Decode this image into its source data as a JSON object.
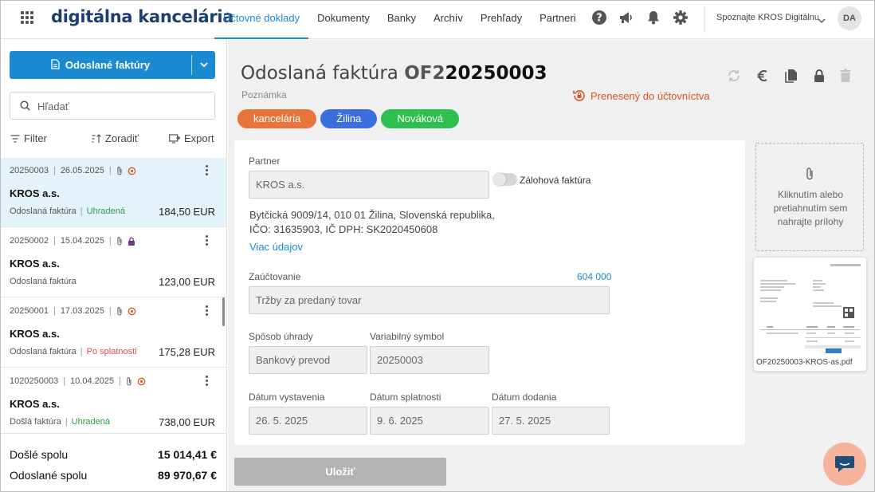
{
  "app": {
    "logo": "digitálna kancelária"
  },
  "nav": [
    "Účtovné doklady",
    "Dokumenty",
    "Banky",
    "Archív",
    "Prehľady",
    "Partneri"
  ],
  "header": {
    "promo": "Spoznajte KROS Digitálnu",
    "avatar": "DA"
  },
  "sidebar": {
    "primary_button": "Odoslané faktúry",
    "search_placeholder": "Hľadať",
    "filter": "Filter",
    "sort": "Zoradiť",
    "export": "Export",
    "items": [
      {
        "number": "20250003",
        "date": "26.05.2025",
        "partner": "KROS a.s.",
        "type": "Odoslaná faktúra",
        "status": "Uhradená",
        "amount": "184,50 EUR"
      },
      {
        "number": "20250002",
        "date": "15.04.2025",
        "partner": "KROS a.s.",
        "type": "Odoslaná faktúra",
        "status": "",
        "amount": "123,00 EUR"
      },
      {
        "number": "20250001",
        "date": "17.03.2025",
        "partner": "KROS a.s.",
        "type": "Odoslaná faktúra",
        "status": "Po splatnosti",
        "amount": "175,28 EUR"
      },
      {
        "number": "1020250003",
        "date": "10.04.2025",
        "partner": "KROS a.s.",
        "type": "Došlá faktúra",
        "status": "Uhradená",
        "amount": "738,00 EUR"
      }
    ],
    "totals": [
      {
        "label": "Došlé spolu",
        "value": "15 014,41 €"
      },
      {
        "label": "Odoslané spolu",
        "value": "89 970,67 €"
      }
    ]
  },
  "document": {
    "title_main": "Odoslaná faktúra",
    "title_prefix": "OF2",
    "title_number": "20250003",
    "note": "Poznámka",
    "transfer_status": "Prenesený do účtovníctva",
    "tags": [
      {
        "label": "kancelária",
        "color": "#e8743b"
      },
      {
        "label": "Žilina",
        "color": "#3b6fe0"
      },
      {
        "label": "Nováková",
        "color": "#2fbf4f"
      }
    ],
    "partner_label": "Partner",
    "partner_value": "KROS a.s.",
    "advance_toggle": "Zálohová faktúra",
    "address_line1": "Bytčická 9009/14, 010 01 Žilina, Slovenská republika,",
    "address_line2": "IČO: 31635903, IČ DPH: SK2020450608",
    "more_details": "Viac údajov",
    "posting_label": "Zaúčtovanie",
    "posting_code": "604 000",
    "posting_value": "Tržby za predaný tovar",
    "payment_label": "Spôsob úhrady",
    "payment_value": "Bankový prevod",
    "vs_label": "Variabilný symbol",
    "vs_value": "20250003",
    "issue_label": "Dátum vystavenia",
    "issue_value": "26. 5. 2025",
    "due_label": "Dátum splatnosti",
    "due_value": "9. 6. 2025",
    "delivery_label": "Dátum dodania",
    "delivery_value": "27. 5. 2025",
    "save_button": "Uložiť"
  },
  "attachments": {
    "drop_text": "Kliknutím alebo pretiahnutím sem nahrajte prílohy",
    "file_name": "OF20250003-KROS-as.pdf"
  },
  "colors": {
    "accent": "#1a8bd0",
    "orange": "#d9541e",
    "paid": "#2d9b4a",
    "overdue": "#e04a5a"
  }
}
